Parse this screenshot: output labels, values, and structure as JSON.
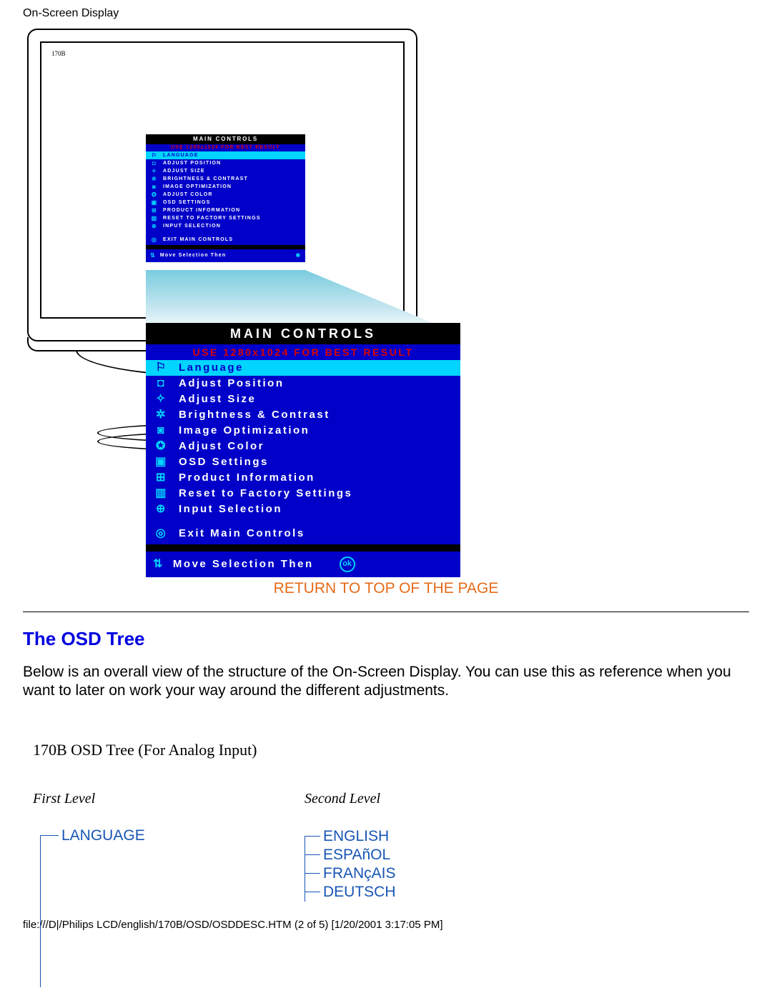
{
  "header": "On-Screen Display",
  "monitor": {
    "brand": "170B"
  },
  "osd": {
    "title": "MAIN CONTROLS",
    "subtitle": "USE 1280x1024 FOR BEST RESULT",
    "items": [
      {
        "icon": "⚐",
        "label": "Language",
        "selected": true
      },
      {
        "icon": "◘",
        "label": "Adjust Position"
      },
      {
        "icon": "✧",
        "label": "Adjust Size"
      },
      {
        "icon": "✲",
        "label": "Brightness & Contrast"
      },
      {
        "icon": "◙",
        "label": "Image Optimization"
      },
      {
        "icon": "✪",
        "label": "Adjust Color"
      },
      {
        "icon": "▣",
        "label": "OSD Settings"
      },
      {
        "icon": "⊞",
        "label": "Product Information"
      },
      {
        "icon": "▥",
        "label": "Reset to Factory Settings"
      },
      {
        "icon": "⊕",
        "label": "Input Selection"
      },
      {
        "icon": "◎",
        "label": "Exit Main Controls",
        "gap": true
      }
    ],
    "footer_icon": "⇅",
    "footer_text": "Move Selection Then",
    "footer_ok": "◉"
  },
  "return_link": "RETURN TO TOP OF THE PAGE",
  "section_heading": "The OSD Tree",
  "section_para": "Below is an overall view of the structure of the On-Screen Display. You can use this as reference when you want to later on work your way around the different adjustments.",
  "tree": {
    "title": "170B OSD Tree (For Analog Input)",
    "col1": "First Level",
    "col2": "Second Level",
    "level1": "LANGUAGE",
    "level2": [
      "ENGLISH",
      "ESPAñOL",
      "FRANçAIS",
      "DEUTSCH"
    ]
  },
  "footer": "file:///D|/Philips LCD/english/170B/OSD/OSDDESC.HTM (2 of 5) [1/20/2001 3:17:05 PM]"
}
